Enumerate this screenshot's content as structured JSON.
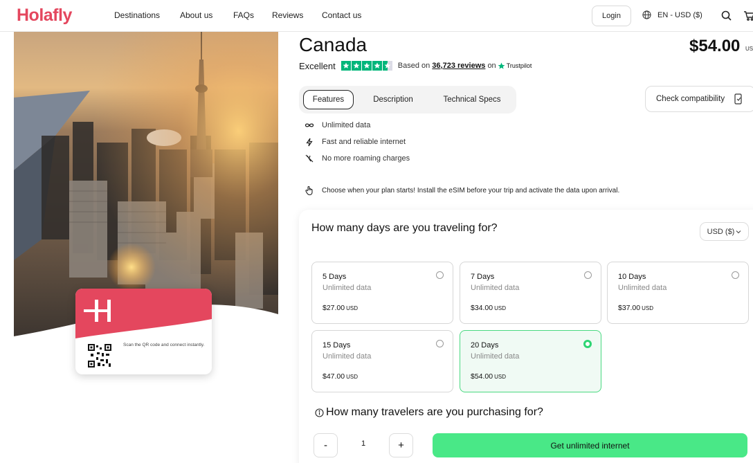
{
  "header": {
    "logo": "Holafly",
    "nav": [
      "Destinations",
      "About us",
      "FAQs",
      "Reviews",
      "Contact us"
    ],
    "login_label": "Login",
    "language": "EN - USD ($)",
    "icons": [
      "globe-icon",
      "search-icon",
      "cart-icon"
    ]
  },
  "hero": {
    "esim_scan_text": "Scan the QR code and connect instantly."
  },
  "product": {
    "title": "Canada",
    "price": "$54.00",
    "price_currency": "US",
    "rating_word": "Excellent",
    "stars": 4.5,
    "based_on": "Based on",
    "reviews_link": "36,723 reviews",
    "on": "on",
    "trustpilot": "Trustpilot"
  },
  "tabs": [
    {
      "label": "Features",
      "active": true
    },
    {
      "label": "Description",
      "active": false
    },
    {
      "label": "Technical Specs",
      "active": false
    }
  ],
  "check_compat_label": "Check compatibility",
  "features": [
    {
      "icon": "infinity-icon",
      "text": "Unlimited data"
    },
    {
      "icon": "lightning-icon",
      "text": "Fast and reliable internet"
    },
    {
      "icon": "no-roaming-icon",
      "text": "No more roaming charges"
    }
  ],
  "notice": "Choose when your plan starts! Install the eSIM before your trip and activate the data upon arrival.",
  "plan_panel": {
    "question": "How many days are you traveling for?",
    "currency_select": "USD ($)",
    "plans": [
      {
        "name": "5 Days",
        "data": "Unlimited data",
        "price": "$27.00",
        "currency": "USD",
        "selected": false
      },
      {
        "name": "7 Days",
        "data": "Unlimited data",
        "price": "$34.00",
        "currency": "USD",
        "selected": false
      },
      {
        "name": "10 Days",
        "data": "Unlimited data",
        "price": "$37.00",
        "currency": "USD",
        "selected": false
      },
      {
        "name": "15 Days",
        "data": "Unlimited data",
        "price": "$47.00",
        "currency": "USD",
        "selected": false
      },
      {
        "name": "20 Days",
        "data": "Unlimited data",
        "price": "$54.00",
        "currency": "USD",
        "selected": true
      }
    ],
    "travelers_question": "How many travelers are you purchasing for?",
    "qty_minus": "-",
    "qty_value": "1",
    "qty_plus": "+",
    "cta_label": "Get unlimited internet"
  },
  "colors": {
    "brand": "#e4475e",
    "cta": "#49e887",
    "trustpilot": "#00b67a",
    "selected_border": "#49d980"
  }
}
